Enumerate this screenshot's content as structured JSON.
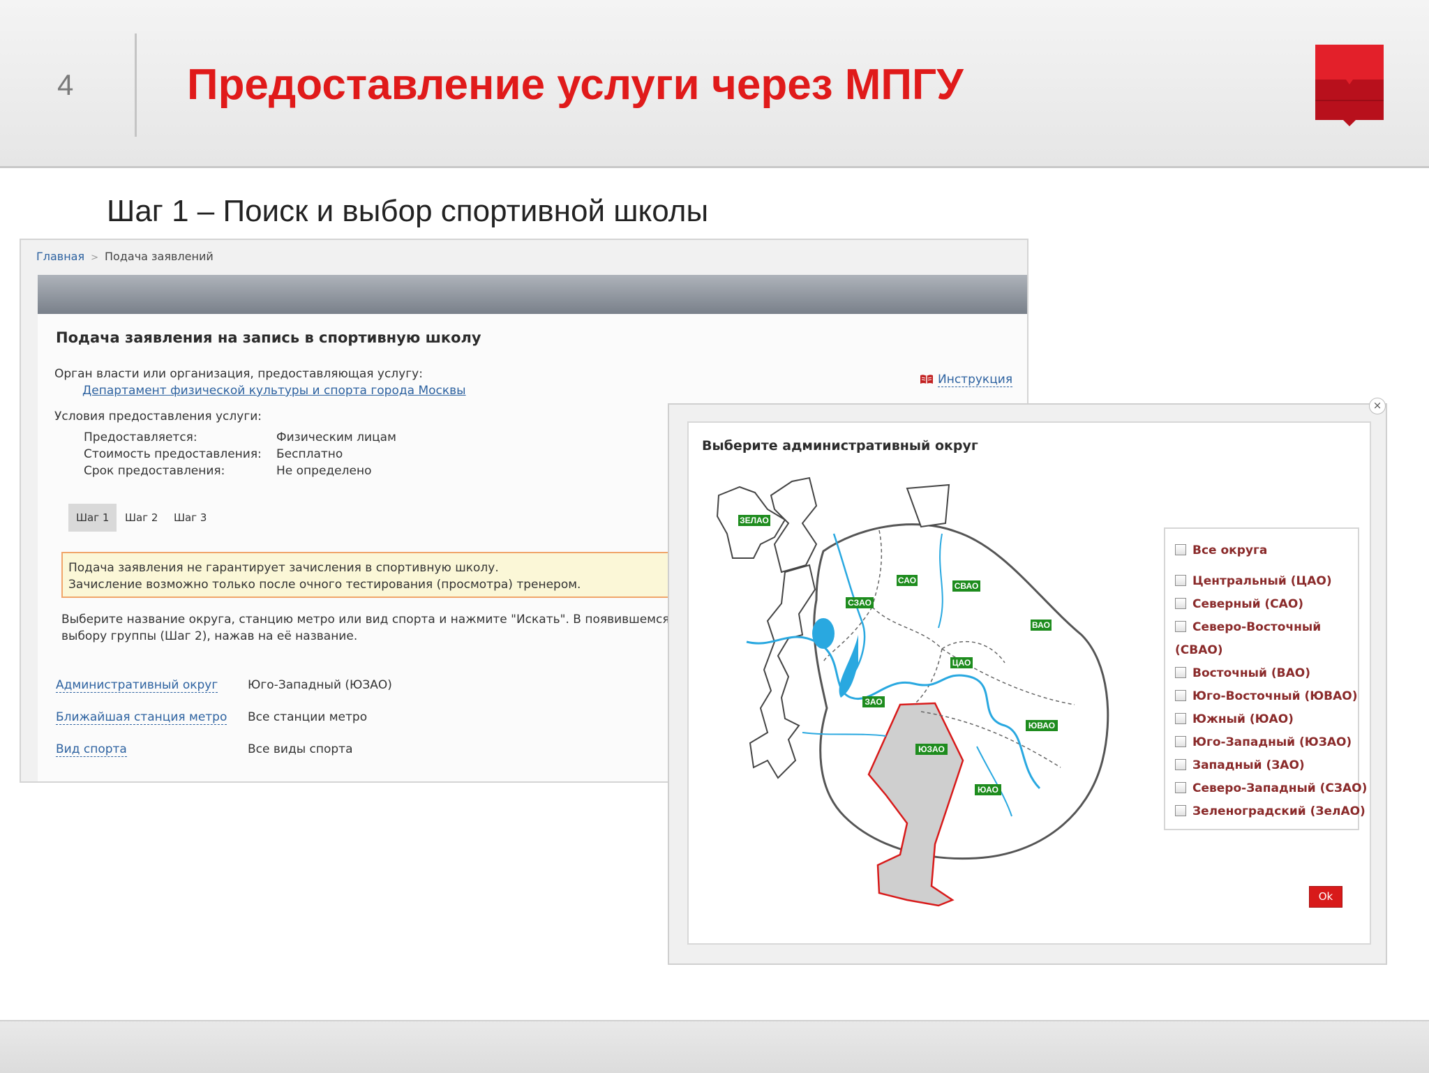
{
  "slide": {
    "number": "4",
    "title": "Предоставление услуги через МПГУ",
    "step_heading": "Шаг 1 – Поиск и выбор спортивной школы",
    "accent_color": "#e01a1a"
  },
  "portal": {
    "breadcrumb": [
      "Главная",
      "Подача заявлений"
    ],
    "page_title": "Подача заявления на запись в спортивную школу",
    "instruction_link": "Инструкция",
    "provider_label": "Орган власти или организация, предоставляющая услугу:",
    "provider_link": "Департамент физической культуры и спорта города Москвы",
    "conditions_label": "Условия предоставления услуги:",
    "conditions": [
      {
        "label": "Предоставляется:",
        "value": "Физическим лицам"
      },
      {
        "label": "Стоимость предоставления:",
        "value": "Бесплатно"
      },
      {
        "label": "Срок предоставления:",
        "value": "Не определено"
      }
    ],
    "tabs": [
      "Шаг 1",
      "Шаг 2",
      "Шаг 3"
    ],
    "active_tab": "Шаг 1",
    "warning_lines": [
      "Подача заявления не гарантирует зачисления в спортивную школу.",
      "Зачисление возможно только после очного тестирования (просмотра) тренером."
    ],
    "help_lines": [
      "Выберите название округа, станцию метро или вид спорта и нажмите \"Искать\". В появившемся списке",
      "выбору группы (Шаг 2), нажав на её название."
    ],
    "filters": [
      {
        "label": "Административный округ",
        "value": "Юго-Западный (ЮЗАО)"
      },
      {
        "label": "Ближайшая станция метро",
        "value": "Все станции метро"
      },
      {
        "label": "Вид спорта",
        "value": "Все виды спорта"
      }
    ]
  },
  "modal": {
    "close_icon": "close-icon",
    "title": "Выберите административный округ",
    "map_labels": [
      "ЗЕЛАО",
      "САО",
      "СВАО",
      "СЗАО",
      "ВАО",
      "ЦАО",
      "ЗАО",
      "ЮВАО",
      "ЮЗАО",
      "ЮАО"
    ],
    "selected_district": "ЮЗАО",
    "districts": [
      "Все округа",
      "Центральный (ЦАО)",
      "Северный (САО)",
      "Северо-Восточный",
      "(СВАО)",
      "Восточный (ВАО)",
      "Юго-Восточный (ЮВАО)",
      "Южный (ЮАО)",
      "Юго-Западный (ЮЗАО)",
      "Западный (ЗАО)",
      "Северо-Западный (СЗАО)",
      "Зеленоградский (ЗелАО)"
    ],
    "ok_label": "Ok",
    "label_color": "#1e8c1e",
    "water_color": "#29a8e0",
    "selected_fill": "#d0d0d0",
    "selected_border": "#d81a1a"
  }
}
